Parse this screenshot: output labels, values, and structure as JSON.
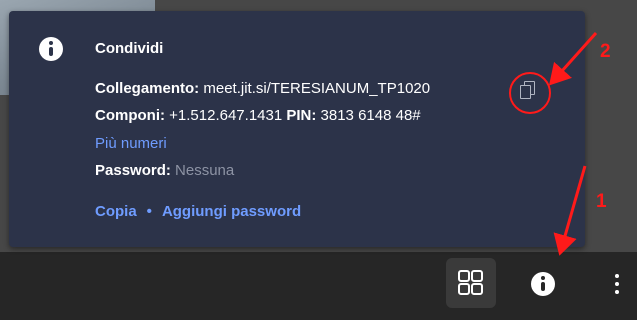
{
  "popup": {
    "title": "Condividi",
    "link_label": "Collegamento:",
    "link_value": "meet.jit.si/TERESIANUM_TP1020",
    "dial_label": "Componi:",
    "dial_number": "+1.512.647.1431",
    "pin_label": "PIN:",
    "pin_value": "3813 6148 48#",
    "more_numbers": "Più numeri",
    "password_label": "Password:",
    "password_value": "Nessuna",
    "actions": {
      "copy": "Copia",
      "separator": "•",
      "add_password": "Aggiungi password"
    }
  },
  "icons": {
    "popup_info": "info-icon",
    "copy": "copy-icon",
    "tile_view": "grid-icon",
    "toolbar_info": "info-icon",
    "more": "more-vertical-icon"
  },
  "annotations": {
    "label_1": "1",
    "label_2": "2",
    "color": "#ff1a1a"
  },
  "colors": {
    "popup_bg": "#2c3349",
    "link": "#6f9cff",
    "toolbar_bg": "#262626"
  }
}
